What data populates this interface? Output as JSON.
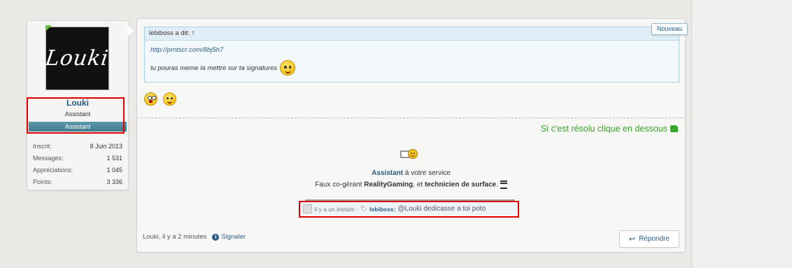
{
  "user": {
    "avatar_text": "Louki",
    "name": "Louki",
    "title": "Assistant",
    "banner": "Assistant",
    "stats": [
      {
        "label": "Inscrit:",
        "value": "8 Juin 2013"
      },
      {
        "label": "Messages:",
        "value": "1 531"
      },
      {
        "label": "Appréciations:",
        "value": "1 045"
      },
      {
        "label": "Points:",
        "value": "3 336"
      }
    ]
  },
  "post": {
    "badge": "Nouveau",
    "quote": {
      "header": "lebiboss a dit: ↑",
      "link": "http://prntscr.com/8bj5h7",
      "text": "tu pouras meme la mettre sur ta signatures"
    },
    "resolu": "Si c'est résolu clique en dessous",
    "signature": {
      "line1_bold": "Assistant",
      "line1_rest": " à votre service",
      "line2_a": "Faux co-gérant ",
      "line2_b": "RealityGaming",
      "line2_c": ", et ",
      "line2_d": "technicien de surface",
      "line2_e": "."
    },
    "status_bar": {
      "time": "Il y a un instant -",
      "user": "lebiboss:",
      "message": "@Louki dedicasse a toi poto"
    },
    "footer": {
      "meta": "Louki, il y a 2 minutes",
      "report": "Signaler",
      "reply": "Répondre"
    }
  },
  "colors": {
    "accent": "#245a80",
    "highlight": "#e10000",
    "resolu": "#3aa52a"
  }
}
